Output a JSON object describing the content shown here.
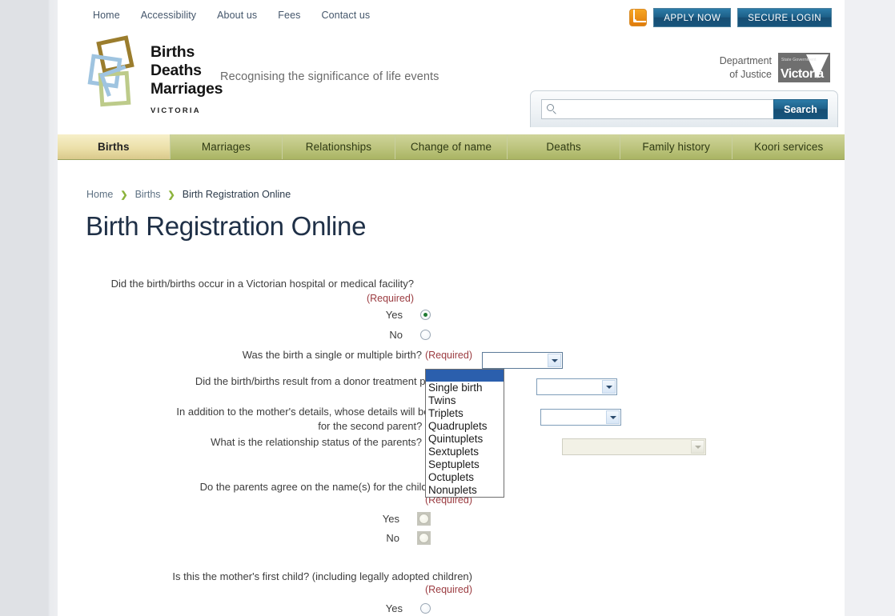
{
  "utility_nav": [
    {
      "label": "Home"
    },
    {
      "label": "Accessibility"
    },
    {
      "label": "About us"
    },
    {
      "label": "Fees"
    },
    {
      "label": "Contact us"
    }
  ],
  "top_actions": {
    "rss_icon": "rss-icon",
    "apply_now": "APPLY NOW",
    "secure_login": "SECURE LOGIN"
  },
  "logo": {
    "line1": "Births",
    "line2": "Deaths",
    "line3": "Marriages",
    "state": "VICTORIA",
    "tagline": "Recognising the significance of life events"
  },
  "department": {
    "line1": "Department",
    "line2": "of Justice",
    "state_government": "State Government",
    "victoria": "Victoria"
  },
  "search": {
    "placeholder": "",
    "value": "",
    "button_label": "Search",
    "icon": "search-icon"
  },
  "main_nav": [
    {
      "label": "Births",
      "active": true
    },
    {
      "label": "Marriages",
      "active": false
    },
    {
      "label": "Relationships",
      "active": false
    },
    {
      "label": "Change of name",
      "active": false
    },
    {
      "label": "Deaths",
      "active": false
    },
    {
      "label": "Family history",
      "active": false
    },
    {
      "label": "Koori services",
      "active": false
    }
  ],
  "breadcrumb": {
    "items": [
      {
        "label": "Home",
        "link": true
      },
      {
        "label": "Births",
        "link": true
      },
      {
        "label": "Birth Registration Online",
        "link": false
      }
    ],
    "separator": "❯"
  },
  "page_title": "Birth Registration Online",
  "form": {
    "required_tag": "(Required)",
    "q1": {
      "question": "Did the birth/births occur in a Victorian hospital or medical facility?",
      "yes_label": "Yes",
      "no_label": "No",
      "selected": "Yes"
    },
    "q2": {
      "question": "Was the birth a single or multiple birth?",
      "value": "",
      "options": [
        "",
        "Single birth",
        "Twins",
        "Triplets",
        "Quadruplets",
        "Quintuplets",
        "Sextuplets",
        "Septuplets",
        "Octuplets",
        "Nonuplets"
      ],
      "open": true,
      "highlighted_index": 0
    },
    "q3": {
      "question": "Did the birth/births result from a donor treatment procedure?",
      "value": ""
    },
    "q4": {
      "question_line1": "In addition to the mother's details, whose details will be provided",
      "question_line2": "for the second parent?",
      "value": ""
    },
    "q5": {
      "question": "What is the relationship status of the parents?",
      "value": "",
      "disabled": true
    },
    "q6": {
      "question": "Do the parents agree on the name(s) for the child/children?",
      "yes_label": "Yes",
      "no_label": "No",
      "disabled": true
    },
    "q7": {
      "question": "Is this the mother's first child? (including legally adopted children)",
      "yes_label": "Yes"
    }
  },
  "colors": {
    "accent_blue": "#1d5f88",
    "nav_olive": "#bcc47d",
    "nav_active": "#ece0a9",
    "required_red": "#9b3b40",
    "title_navy": "#1f3047",
    "highlight_blue": "#2b5fad"
  }
}
